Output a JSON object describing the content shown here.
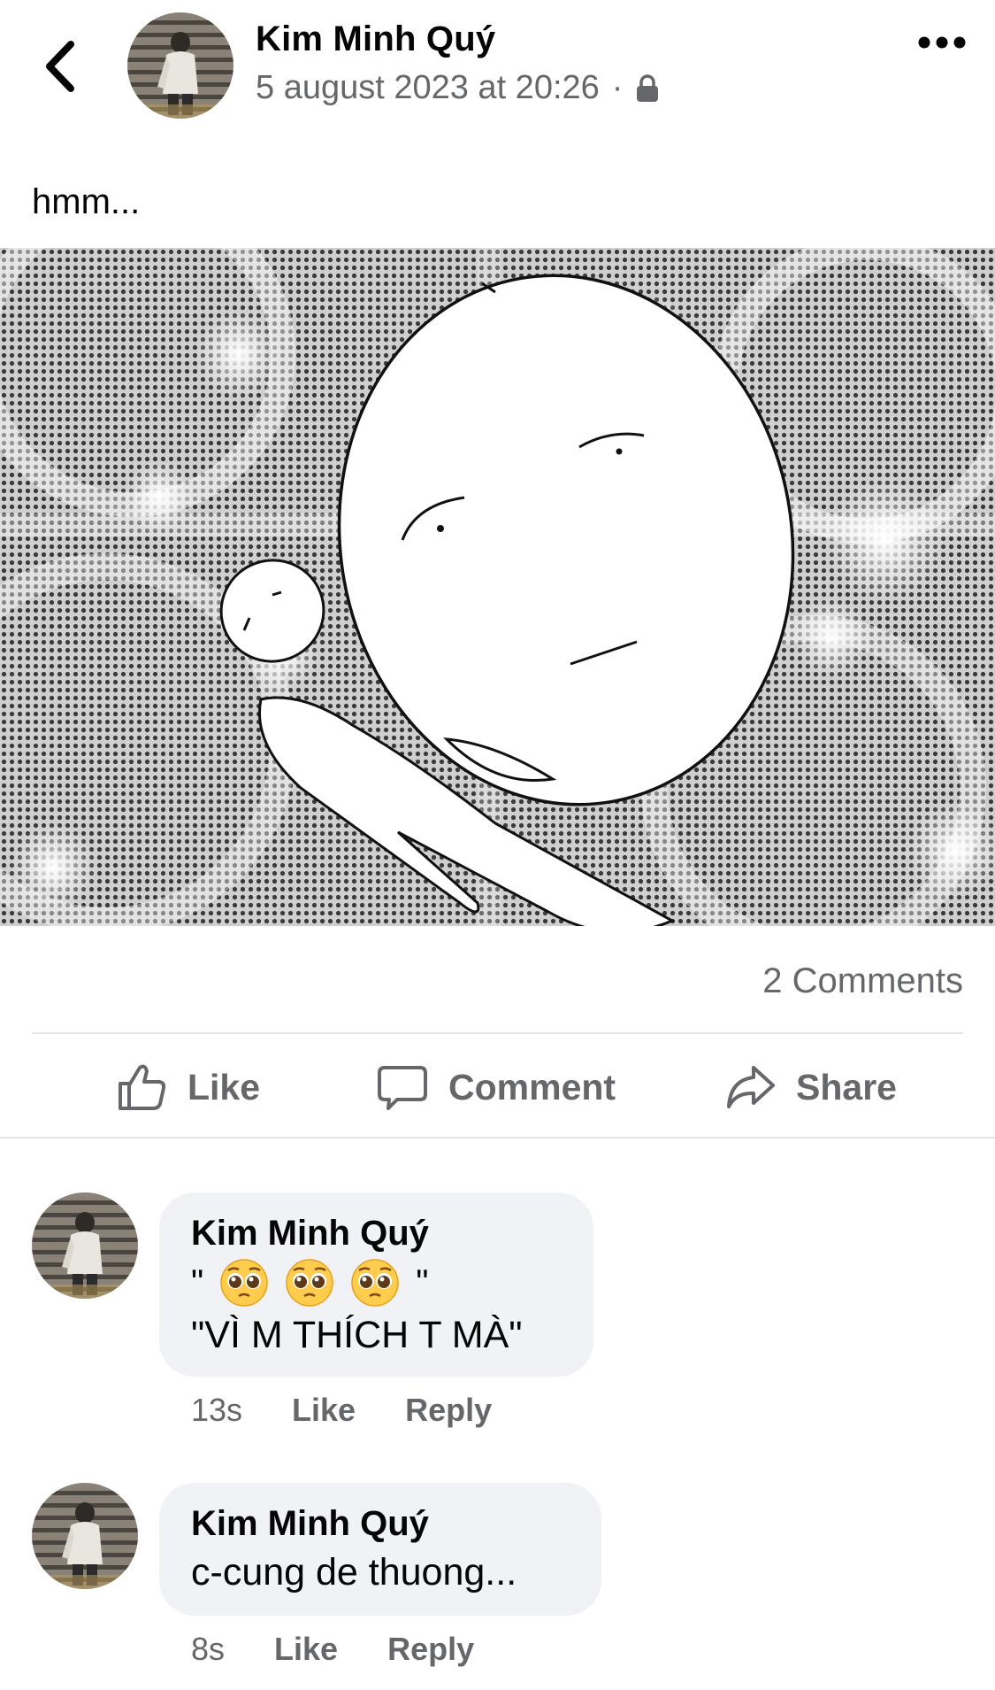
{
  "header": {
    "author": "Kim Minh Quý",
    "timestamp": "5 august 2023 at 20:26",
    "separator": "·",
    "privacy_icon": "lock-icon",
    "back_icon": "chevron-left-icon",
    "more_icon": "more-horizontal-icon"
  },
  "post": {
    "text": "hmm...",
    "comments_count": "2 Comments"
  },
  "actions": {
    "like": "Like",
    "comment": "Comment",
    "share": "Share"
  },
  "comments": [
    {
      "name": "Kim Minh Quý",
      "line1_open": "\"",
      "line1_close": "\"",
      "emoji": "pleading-face-icon",
      "line2": "\"VÌ M THÍCH T MÀ\"",
      "time": "13s",
      "like": "Like",
      "reply": "Reply"
    },
    {
      "name": "Kim Minh Quý",
      "text": "c-cung de thuong...",
      "time": "8s",
      "like": "Like",
      "reply": "Reply"
    }
  ],
  "colors": {
    "secondary_text": "#65676b",
    "bubble": "#f0f2f5",
    "divider": "#e4e6eb"
  }
}
